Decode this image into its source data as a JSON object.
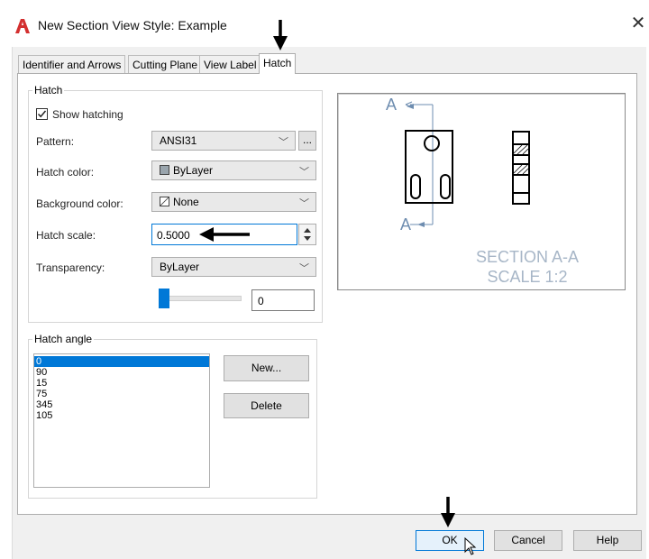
{
  "window": {
    "title": "New Section View Style: Example",
    "close_glyph": "✕"
  },
  "tabs": [
    {
      "label": "Identifier and Arrows",
      "active": false
    },
    {
      "label": "Cutting Plane",
      "active": false
    },
    {
      "label": "View Label",
      "active": false
    },
    {
      "label": "Hatch",
      "active": true
    }
  ],
  "hatch_group": {
    "title": "Hatch",
    "show_hatching": {
      "label": "Show hatching",
      "checked": true
    },
    "pattern": {
      "label": "Pattern:",
      "value": "ANSI31",
      "browse_label": "..."
    },
    "hatch_color": {
      "label": "Hatch color:",
      "value": "ByLayer",
      "swatch": "#9aa5ad"
    },
    "background_color": {
      "label": "Background color:",
      "value": "None"
    },
    "hatch_scale": {
      "label": "Hatch scale:",
      "value": "0.5000"
    },
    "transparency": {
      "label": "Transparency:",
      "value": "ByLayer",
      "level": 0,
      "level_text": "0"
    }
  },
  "hatch_angle_group": {
    "title": "Hatch angle",
    "angles": [
      "0",
      "90",
      "15",
      "75",
      "345",
      "105"
    ],
    "selected_index": 0,
    "new_label": "New...",
    "delete_label": "Delete"
  },
  "preview": {
    "section_label_top": "A",
    "section_label_bottom": "A",
    "caption_line1": "SECTION A-A",
    "caption_line2": "SCALE 1:2",
    "caption_color": "#a7b6c7",
    "leader_color": "#6e8db0"
  },
  "footer": {
    "ok_label": "OK",
    "cancel_label": "Cancel",
    "help_label": "Help"
  },
  "colors": {
    "accent": "#0078d7",
    "app_icon": "#d32f2f"
  }
}
